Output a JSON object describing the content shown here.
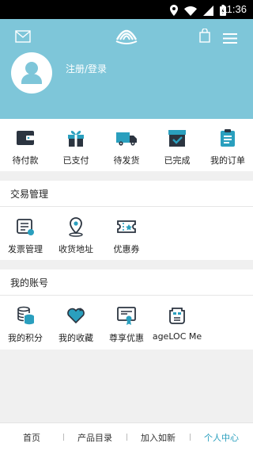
{
  "status_bar": {
    "time": "11:36",
    "icons": [
      "location-icon",
      "wifi-icon",
      "signal-icon",
      "battery-icon"
    ]
  },
  "header": {
    "login_text": "注册/登录",
    "icons": [
      "mail-icon",
      "nu-skin-logo",
      "shopping-bag-icon",
      "menu-icon",
      "avatar-icon"
    ],
    "background": "#7ec6d9"
  },
  "orders": [
    {
      "label": "待付款",
      "icon": "wallet-icon"
    },
    {
      "label": "已支付",
      "icon": "gift-icon"
    },
    {
      "label": "待发货",
      "icon": "truck-icon"
    },
    {
      "label": "已完成",
      "icon": "completed-box-icon"
    },
    {
      "label": "我的订单",
      "icon": "clipboard-icon"
    }
  ],
  "transactions": {
    "title": "交易管理",
    "items": [
      {
        "label": "发票管理",
        "icon": "invoice-icon"
      },
      {
        "label": "收货地址",
        "icon": "location-pin-icon"
      },
      {
        "label": "优惠券",
        "icon": "coupon-icon"
      }
    ]
  },
  "account": {
    "title": "我的账号",
    "items": [
      {
        "label": "我的积分",
        "icon": "coins-icon"
      },
      {
        "label": "我的收藏",
        "icon": "heart-icon"
      },
      {
        "label": "尊享优惠",
        "icon": "certificate-icon"
      },
      {
        "label": "ageLOC Me",
        "icon": "ageloc-me-icon"
      }
    ]
  },
  "tabbar": [
    {
      "label": "首页",
      "active": false
    },
    {
      "label": "产品目录",
      "active": false
    },
    {
      "label": "加入如新",
      "active": false
    },
    {
      "label": "个人中心",
      "active": true
    }
  ],
  "colors": {
    "accent": "#2a9fbe",
    "header": "#7ec6d9",
    "icon_blue": "#2a9fbe",
    "icon_dark": "#2b3440"
  }
}
